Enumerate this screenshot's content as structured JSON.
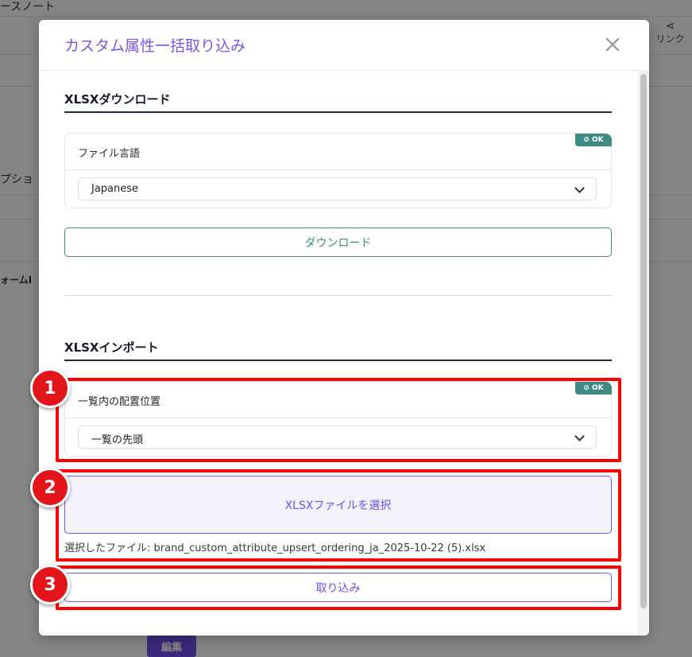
{
  "background": {
    "top_text": "ースノート",
    "share_label": "リンク",
    "side_text_1": "プショ",
    "side_text_2": "ォームI",
    "edit_button": "編集"
  },
  "modal": {
    "title": "カスタム属性一括取り込み",
    "download_section": {
      "title": "XLSXダウンロード",
      "field_label": "ファイル言語",
      "badge": "OK",
      "select_value": "Japanese",
      "button": "ダウンロード"
    },
    "import_section": {
      "title": "XLSXインポート",
      "field_label": "一覧内の配置位置",
      "badge": "OK",
      "select_value": "一覧の先頭",
      "file_button": "XLSXファイルを選択",
      "selected_file": "選択したファイル: brand_custom_attribute_upsert_ordering_ja_2025-10-22 (5).xlsx",
      "import_button": "取り込み"
    }
  },
  "annotations": {
    "one": "1",
    "two": "2",
    "three": "3"
  },
  "colors": {
    "accent": "#7a55e0",
    "teal": "#3f8b84",
    "annotation_red": "#ff0000"
  }
}
